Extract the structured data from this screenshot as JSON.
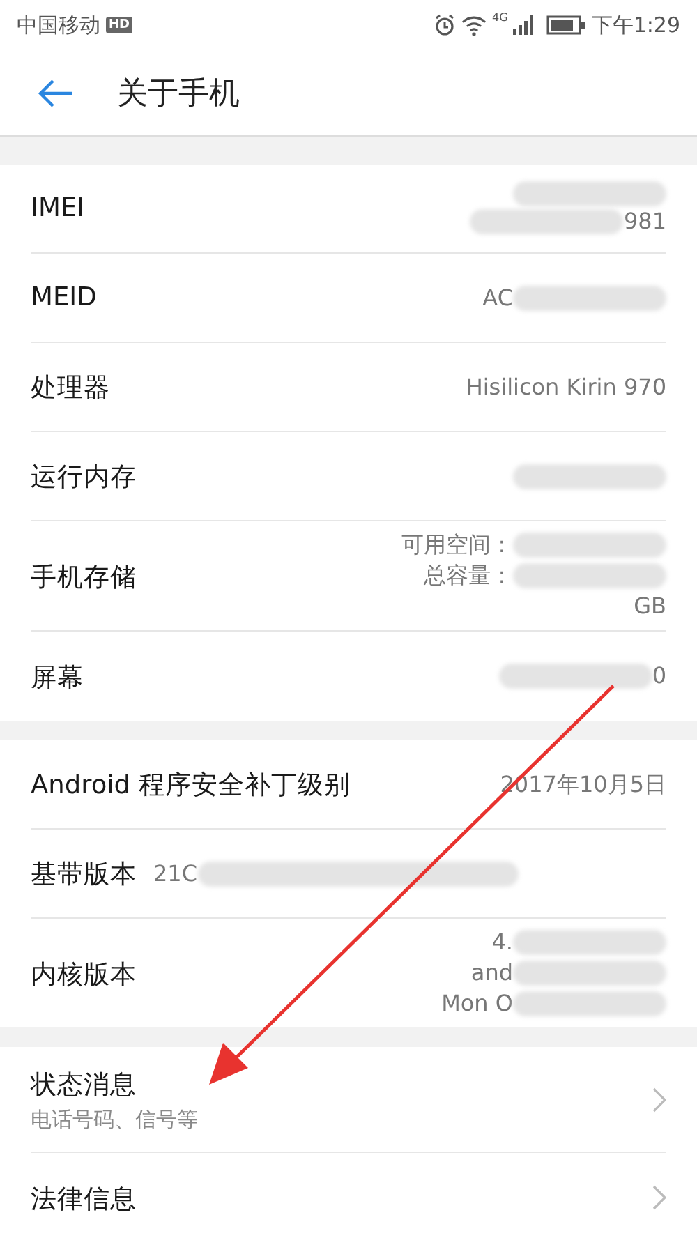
{
  "status_bar": {
    "carrier": "中国移动",
    "hd_badge": "HD",
    "network": "4G",
    "time": "下午1:29"
  },
  "header": {
    "title": "关于手机"
  },
  "sections": [
    {
      "rows": [
        {
          "kind": "value",
          "label": "IMEI",
          "lines": [
            {
              "blur_before": true
            },
            {
              "text": "981",
              "blur_before": true
            }
          ]
        },
        {
          "kind": "value",
          "label": "MEID",
          "lines": [
            {
              "text": "AC",
              "blur_after": true
            }
          ]
        },
        {
          "kind": "value",
          "label": "处理器",
          "lines": [
            {
              "text": "Hisilicon Kirin 970"
            }
          ]
        },
        {
          "kind": "value",
          "label": "运行内存",
          "lines": [
            {
              "blur_before": true
            }
          ]
        },
        {
          "kind": "value",
          "label": "手机存储",
          "lines": [
            {
              "text": "可用空间：",
              "blur_after": true
            },
            {
              "text": "总容量：",
              "blur_after": true
            },
            {
              "text": "GB"
            }
          ]
        },
        {
          "kind": "value",
          "label": "屏幕",
          "lines": [
            {
              "text": "0",
              "blur_before": true
            }
          ]
        }
      ]
    },
    {
      "rows": [
        {
          "kind": "value",
          "label": "Android 程序安全补丁级别",
          "lines": [
            {
              "text": "2017年10月5日"
            }
          ]
        },
        {
          "kind": "inline",
          "label": "基带版本",
          "lines": [
            {
              "text": "21C",
              "blur_after": true
            }
          ]
        },
        {
          "kind": "value",
          "label": "内核版本",
          "lines": [
            {
              "text": "4.",
              "blur_after": true
            },
            {
              "text": "and",
              "blur_after": true
            },
            {
              "text": "Mon O",
              "blur_after": true
            }
          ]
        }
      ]
    },
    {
      "rows": [
        {
          "kind": "link",
          "label": "状态消息",
          "subtitle": "电话号码、信号等"
        },
        {
          "kind": "link",
          "label": "法律信息"
        }
      ]
    }
  ]
}
